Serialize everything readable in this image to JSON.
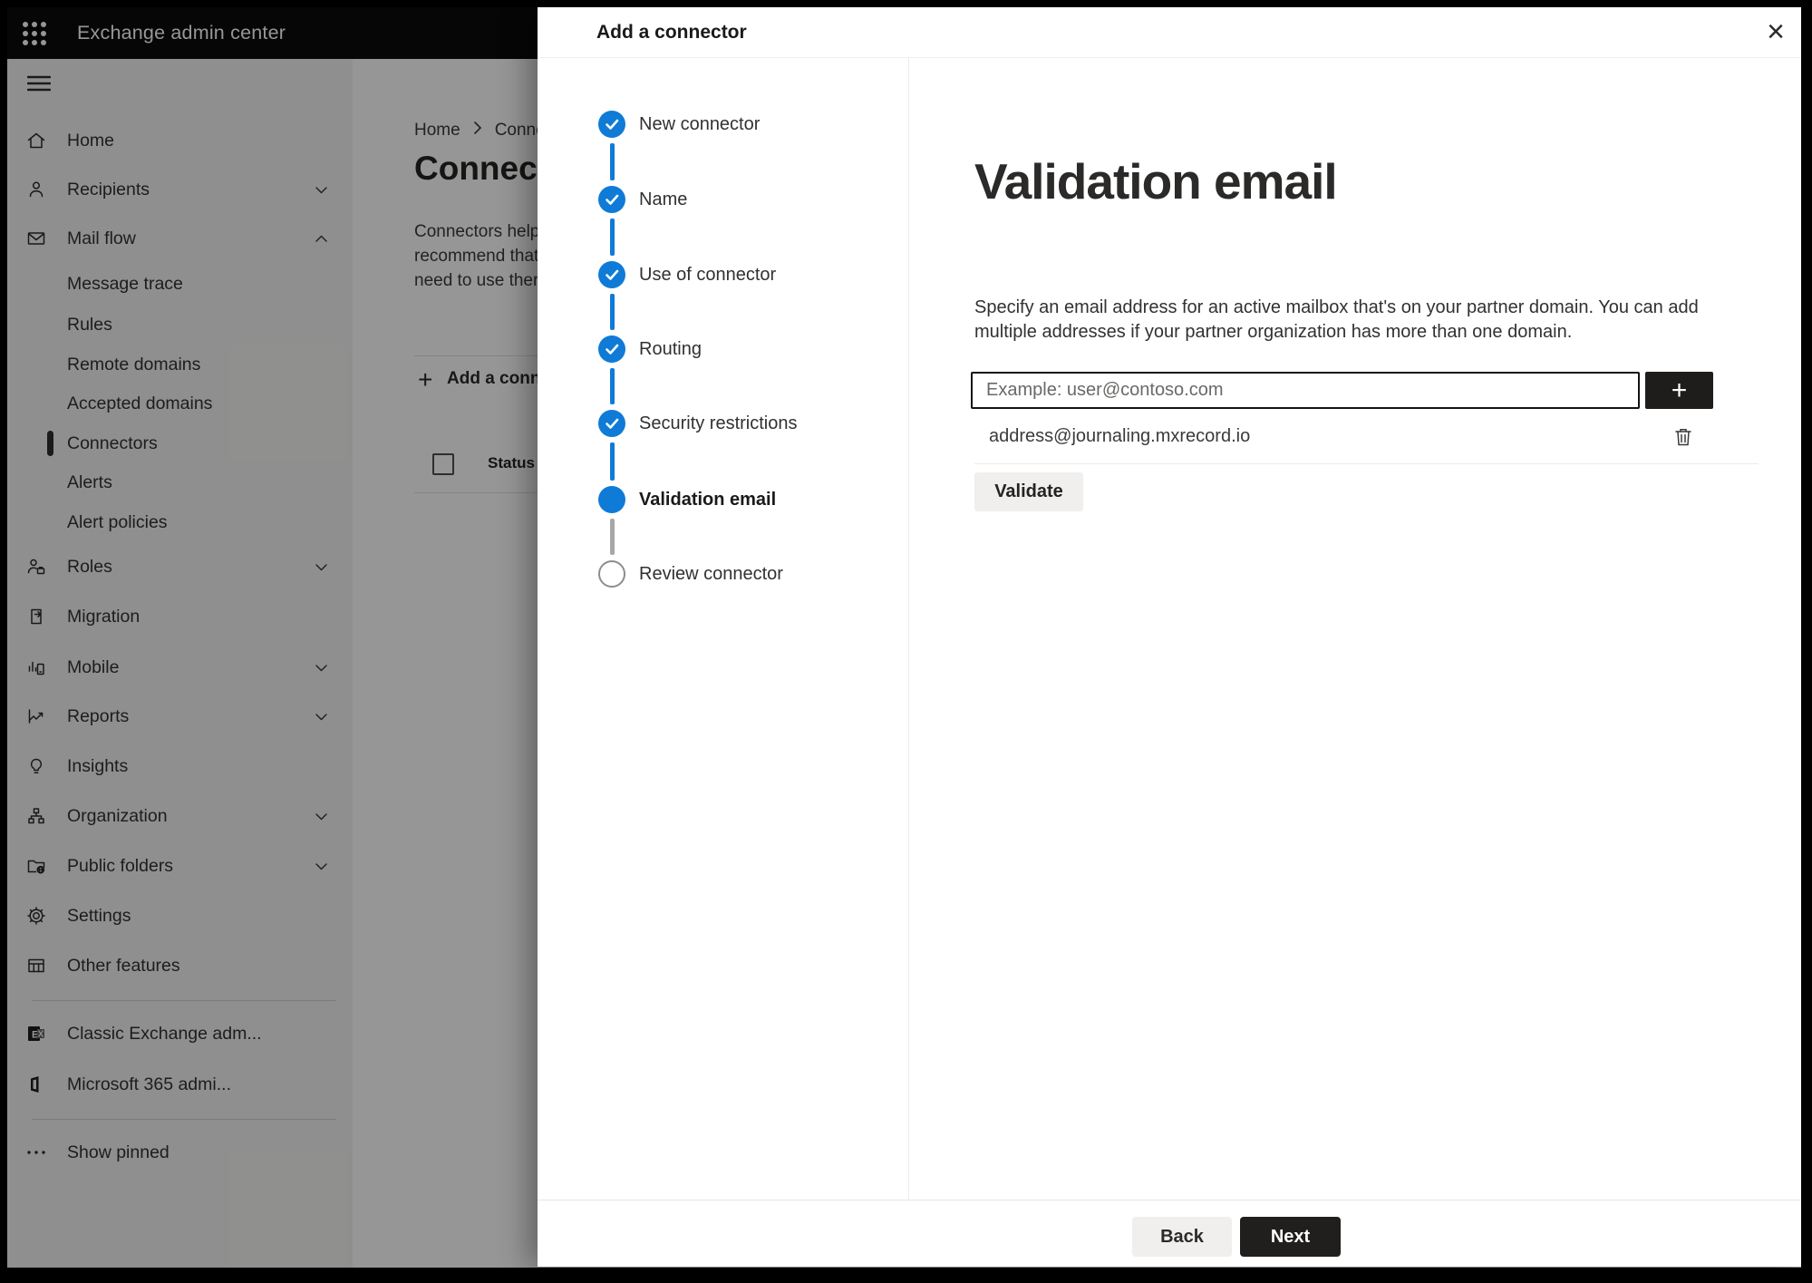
{
  "topbar": {
    "title": "Exchange admin center"
  },
  "sidebar": {
    "items": [
      {
        "label": "Home",
        "icon": "home-icon"
      },
      {
        "label": "Recipients",
        "icon": "person-icon",
        "chevron": "down"
      },
      {
        "label": "Mail flow",
        "icon": "mail-icon",
        "chevron": "up"
      },
      {
        "label": "Message trace",
        "sub": true
      },
      {
        "label": "Rules",
        "sub": true
      },
      {
        "label": "Remote domains",
        "sub": true
      },
      {
        "label": "Accepted domains",
        "sub": true
      },
      {
        "label": "Connectors",
        "sub": true,
        "selected": true
      },
      {
        "label": "Alerts",
        "sub": true
      },
      {
        "label": "Alert policies",
        "sub": true
      },
      {
        "label": "Roles",
        "icon": "roles-icon",
        "chevron": "down"
      },
      {
        "label": "Migration",
        "icon": "migration-icon"
      },
      {
        "label": "Mobile",
        "icon": "mobile-icon",
        "chevron": "down"
      },
      {
        "label": "Reports",
        "icon": "reports-icon",
        "chevron": "down"
      },
      {
        "label": "Insights",
        "icon": "insights-icon"
      },
      {
        "label": "Organization",
        "icon": "organization-icon",
        "chevron": "down"
      },
      {
        "label": "Public folders",
        "icon": "public-folders-icon",
        "chevron": "down"
      },
      {
        "label": "Settings",
        "icon": "settings-icon"
      },
      {
        "label": "Other features",
        "icon": "other-features-icon"
      },
      {
        "divider": true
      },
      {
        "label": "Classic Exchange adm...",
        "icon": "classic-exchange-icon"
      },
      {
        "label": "Microsoft 365 admi...",
        "icon": "m365-icon"
      },
      {
        "divider": true
      },
      {
        "label": "Show pinned",
        "icon": "ellipsis-icon"
      }
    ]
  },
  "background": {
    "breadcrumb": {
      "home": "Home",
      "current": "Connectors"
    },
    "heading": "Connectors",
    "description_lines": [
      "Connectors help",
      "recommend that",
      "need to use ther"
    ],
    "toolbar": {
      "add_label": "Add a connector"
    },
    "table": {
      "status_header": "Status"
    }
  },
  "modal": {
    "title": "Add a connector",
    "close_glyph": "×",
    "steps": [
      {
        "label": "New connector",
        "state": "completed"
      },
      {
        "label": "Name",
        "state": "completed"
      },
      {
        "label": "Use of connector",
        "state": "completed"
      },
      {
        "label": "Routing",
        "state": "completed"
      },
      {
        "label": "Security restrictions",
        "state": "completed"
      },
      {
        "label": "Validation email",
        "state": "current"
      },
      {
        "label": "Review connector",
        "state": "upcoming"
      }
    ],
    "content": {
      "heading": "Validation email",
      "description_line1": "Specify an email address for an active mailbox that's on your partner domain. You can add",
      "description_line2": "multiple addresses if your partner organization has more than one domain.",
      "email_input": {
        "value": "",
        "placeholder": "Example: user@contoso.com"
      },
      "add_address_glyph": "+",
      "addresses": [
        {
          "email": "address@journaling.mxrecord.io"
        }
      ],
      "validate_label": "Validate"
    },
    "footer": {
      "back_label": "Back",
      "next_label": "Next"
    }
  },
  "colors": {
    "accent_blue": "#0f7bd7",
    "dark_button": "#201f1e",
    "light_button": "#f0efee",
    "topbar_bg": "#0b0b0b",
    "sidebar_bg": "#f5f4f3"
  }
}
